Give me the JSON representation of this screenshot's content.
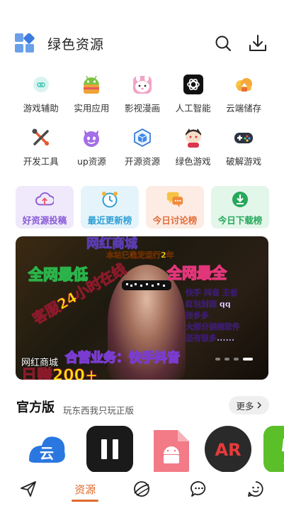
{
  "header": {
    "title": "绿色资源",
    "logo_icon": "grid-logo-icon",
    "search_icon": "search-icon",
    "download_icon": "download-icon"
  },
  "categories": [
    {
      "label": "游戏辅助",
      "icon": "game-assist-icon"
    },
    {
      "label": "实用应用",
      "icon": "android-icon"
    },
    {
      "label": "影视漫画",
      "icon": "bunny-icon"
    },
    {
      "label": "人工智能",
      "icon": "ai-knot-icon"
    },
    {
      "label": "云端储存",
      "icon": "cloud-icon"
    },
    {
      "label": "开发工具",
      "icon": "tools-icon"
    },
    {
      "label": "up资源",
      "icon": "devil-face-icon"
    },
    {
      "label": "开源资源",
      "icon": "cube-icon"
    },
    {
      "label": "绿色游戏",
      "icon": "cat-icon"
    },
    {
      "label": "破解游戏",
      "icon": "gamepad-icon"
    }
  ],
  "ranks": [
    {
      "label": "好资源投稿",
      "icon": "cloud-upload-icon",
      "color": "#8a5bd6",
      "bg": "#efe9fb"
    },
    {
      "label": "最近更新榜",
      "icon": "alarm-clock-icon",
      "color": "#2f9fd6",
      "bg": "#e5f4fb"
    },
    {
      "label": "今日讨论榜",
      "icon": "chat-bubbles-icon",
      "color": "#e26b3a",
      "bg": "#fdece3"
    },
    {
      "label": "今日下载榜",
      "icon": "download-circle-icon",
      "color": "#25a85a",
      "bg": "#e3f6ea"
    }
  ],
  "banner": {
    "top": "网红商城",
    "sub": "本站已稳定运行2年",
    "left": "全网最低",
    "right": "全网最全",
    "right_list": [
      "快手  抖音   王者",
      "红包封面     qq",
      "拼多多",
      "大部分视频软件",
      "还有很多......"
    ],
    "diagonal": "客服24小时在线",
    "partner": "合营业务：快手抖音",
    "caption": "网红商城",
    "bottom": "日赚200+"
  },
  "official": {
    "title": "官方版",
    "subtitle": "玩东西我只玩正版",
    "more": "更多",
    "apps": [
      "cloud-app-icon",
      "pause-app-icon",
      "android-file-app-icon",
      "ar-app-icon",
      "green-app-icon"
    ]
  },
  "nav": {
    "active_label": "资源",
    "items": [
      "send-icon",
      "resources-tab",
      "planet-icon",
      "chat-icon",
      "smile-icon"
    ]
  }
}
